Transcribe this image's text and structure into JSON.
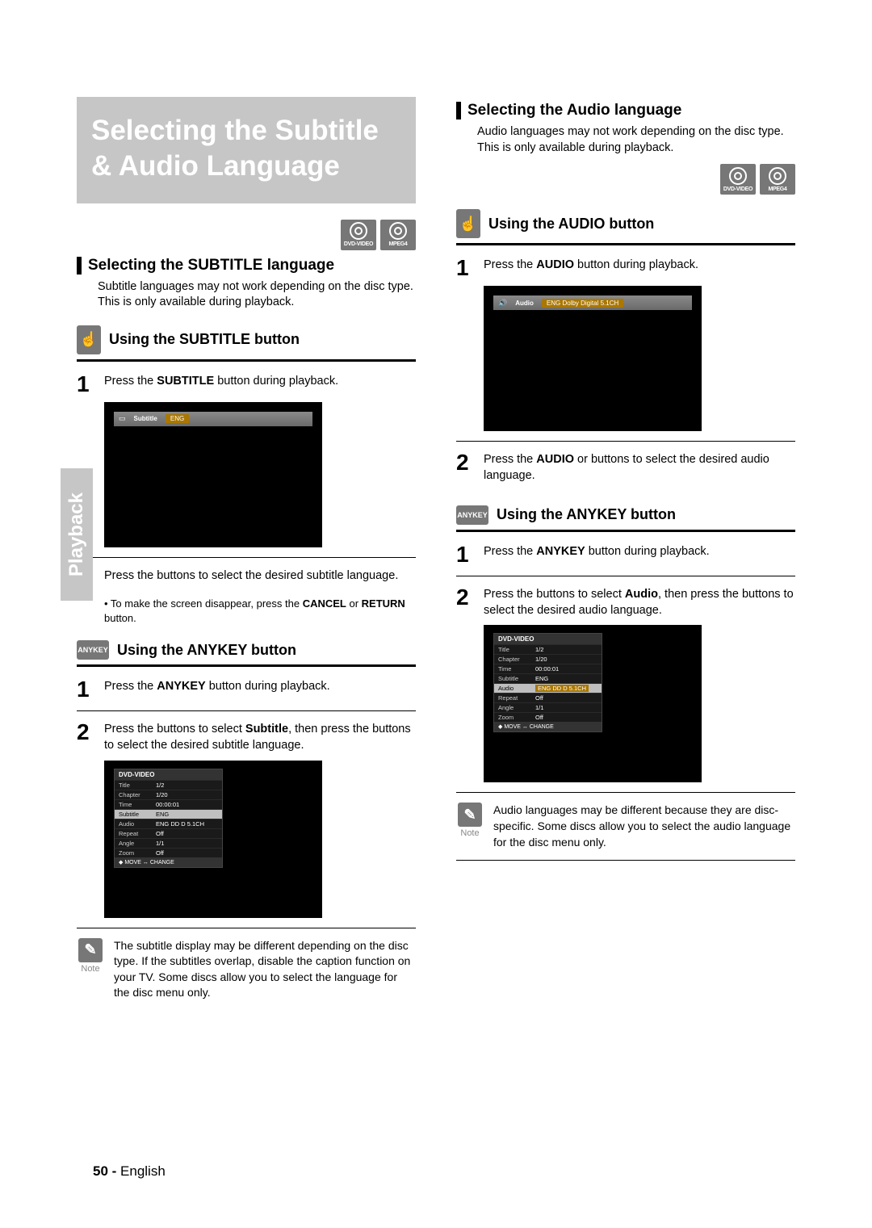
{
  "sidebar_tab": "Playback",
  "page_number": "50 -",
  "page_lang": "English",
  "disc_labels": {
    "dvd": "DVD-VIDEO",
    "mpeg4": "MPEG4"
  },
  "left": {
    "title": "Selecting the Subtitle & Audio Language",
    "section1_heading": "Selecting the SUBTITLE language",
    "section1_body": "Subtitle languages may not work depending on the disc type. This is only available during playback.",
    "sub1_heading": "Using the SUBTITLE button",
    "step1_prefix": "Press the ",
    "step1_bold": "SUBTITLE",
    "step1_suffix": " button during playback.",
    "osd1": {
      "label": "Subtitle",
      "value": "ENG"
    },
    "step2_a": "Press the ",
    "step2_b": " buttons to select the desired subtitle language.",
    "bullet_a": "• To make the screen disappear, press the ",
    "bullet_bold1": "CANCEL",
    "bullet_mid": " or ",
    "bullet_bold2": "RETURN",
    "bullet_end": " button.",
    "anykey_label": "ANYKEY",
    "sub2_heading": "Using the ANYKEY button",
    "anykey_step1_a": "Press the ",
    "anykey_step1_bold": "ANYKEY",
    "anykey_step1_b": " button during playback.",
    "anykey_step2_a": "Press the ",
    "anykey_step2_b": " buttons to select ",
    "anykey_step2_bold": "Subtitle",
    "anykey_step2_c": ", then press the ",
    "anykey_step2_d": " buttons to select the desired subtitle language.",
    "osd_panel": {
      "header": "DVD-VIDEO",
      "rows": [
        {
          "k": "Title",
          "v": "1/2"
        },
        {
          "k": "Chapter",
          "v": "1/20"
        },
        {
          "k": "Time",
          "v": "00:00:01"
        },
        {
          "k": "Subtitle",
          "v": "ENG",
          "hl": true
        },
        {
          "k": "Audio",
          "v": "ENG DD D 5.1CH"
        },
        {
          "k": "Repeat",
          "v": "Off"
        },
        {
          "k": "Angle",
          "v": "1/1"
        },
        {
          "k": "Zoom",
          "v": "Off"
        }
      ],
      "footer": "◆ MOVE   ↔ CHANGE"
    },
    "note_label": "Note",
    "note_text": "The subtitle display may be different depending on the disc type.\nIf the subtitles overlap, disable the caption function on your TV.\nSome discs allow you to select the language for the disc menu only."
  },
  "right": {
    "section_heading": "Selecting the Audio language",
    "section_body": "Audio languages may not work depending on the disc type. This is only available during playback.",
    "sub1_heading": "Using the AUDIO button",
    "step1_prefix": "Press the ",
    "step1_bold": "AUDIO",
    "step1_suffix": " button during playback.",
    "osd1": {
      "label": "Audio",
      "value": "ENG Dolby Digital 5.1CH"
    },
    "step2_a": "Press the ",
    "step2_bold": "AUDIO",
    "step2_b": " or ",
    "step2_c": " buttons to select the desired audio language.",
    "anykey_label": "ANYKEY",
    "sub2_heading": "Using the ANYKEY button",
    "anykey_step1_a": "Press the ",
    "anykey_step1_bold": "ANYKEY",
    "anykey_step1_b": " button during playback.",
    "anykey_step2_a": "Press the ",
    "anykey_step2_b": " buttons to select ",
    "anykey_step2_bold": "Audio",
    "anykey_step2_c": ", then press the ",
    "anykey_step2_d": " buttons to select the desired audio language.",
    "osd_panel": {
      "header": "DVD-VIDEO",
      "rows": [
        {
          "k": "Title",
          "v": "1/2"
        },
        {
          "k": "Chapter",
          "v": "1/20"
        },
        {
          "k": "Time",
          "v": "00:00:01"
        },
        {
          "k": "Subtitle",
          "v": "ENG"
        },
        {
          "k": "Audio",
          "v": "ENG DD D 5.1CH",
          "hl_orange": true,
          "hl": true
        },
        {
          "k": "Repeat",
          "v": "Off"
        },
        {
          "k": "Angle",
          "v": "1/1"
        },
        {
          "k": "Zoom",
          "v": "Off"
        }
      ],
      "footer": "◆ MOVE   ↔ CHANGE"
    },
    "note_label": "Note",
    "note_text": "Audio languages may be different because they are disc-specific.\nSome discs allow you to select the audio language for the disc menu only."
  }
}
